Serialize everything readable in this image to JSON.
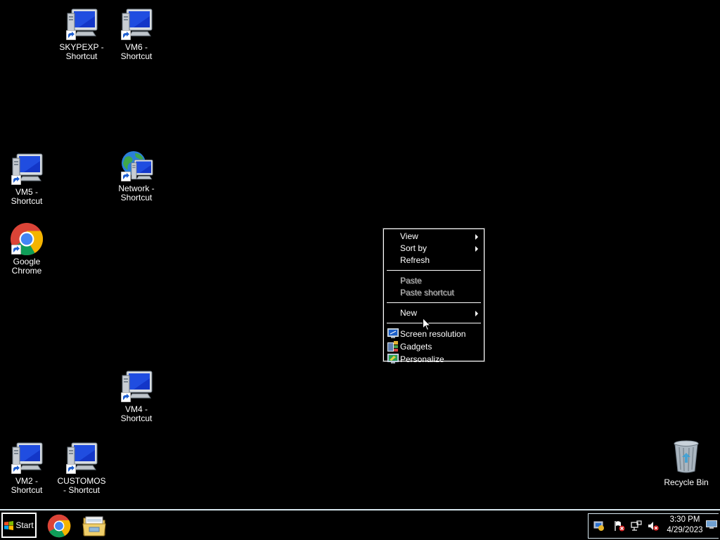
{
  "desktop": {
    "icons": [
      {
        "label": "SKYPEXP -\nShortcut",
        "icon": "computer-shortcut-icon"
      },
      {
        "label": "VM6 -\nShortcut",
        "icon": "computer-shortcut-icon"
      },
      {
        "label": "VM5 -\nShortcut",
        "icon": "computer-shortcut-icon"
      },
      {
        "label": "Network -\nShortcut",
        "icon": "network-shortcut-icon"
      },
      {
        "label": "Google\nChrome",
        "icon": "chrome-icon"
      },
      {
        "label": "VM4 -\nShortcut",
        "icon": "computer-shortcut-icon"
      },
      {
        "label": "VM2 -\nShortcut",
        "icon": "computer-shortcut-icon"
      },
      {
        "label": "CUSTOMOS\n- Shortcut",
        "icon": "computer-shortcut-icon"
      }
    ],
    "recycle_bin": {
      "label": "Recycle Bin",
      "icon": "recycle-bin-icon"
    }
  },
  "context_menu": {
    "items": [
      {
        "label": "View",
        "submenu": true,
        "enabled": true
      },
      {
        "label": "Sort by",
        "submenu": true,
        "enabled": true
      },
      {
        "label": "Refresh",
        "submenu": false,
        "enabled": true
      },
      {
        "label": "Paste",
        "submenu": false,
        "enabled": false
      },
      {
        "label": "Paste shortcut",
        "submenu": false,
        "enabled": false
      },
      {
        "label": "New",
        "submenu": true,
        "enabled": true
      },
      {
        "label": "Screen resolution",
        "icon": "screen-resolution-icon",
        "enabled": true
      },
      {
        "label": "Gadgets",
        "icon": "gadgets-icon",
        "enabled": true
      },
      {
        "label": "Personalize",
        "icon": "personalize-icon",
        "enabled": true
      }
    ]
  },
  "taskbar": {
    "start_label": "Start",
    "pinned": [
      {
        "name": "Google Chrome",
        "icon": "chrome-icon"
      },
      {
        "name": "Windows Explorer",
        "icon": "folder-icon"
      }
    ],
    "tray": {
      "icons": [
        "network-status-icon",
        "action-center-icon",
        "network-icon",
        "volume-muted-icon"
      ],
      "time": "3:30 PM",
      "date": "4/29/2023"
    }
  },
  "colors": {
    "desktop_bg": "#000000",
    "taskbar_border": "#d9e8f0",
    "menu_text": "#ffffff",
    "menu_disabled": "#bdbdbd"
  }
}
